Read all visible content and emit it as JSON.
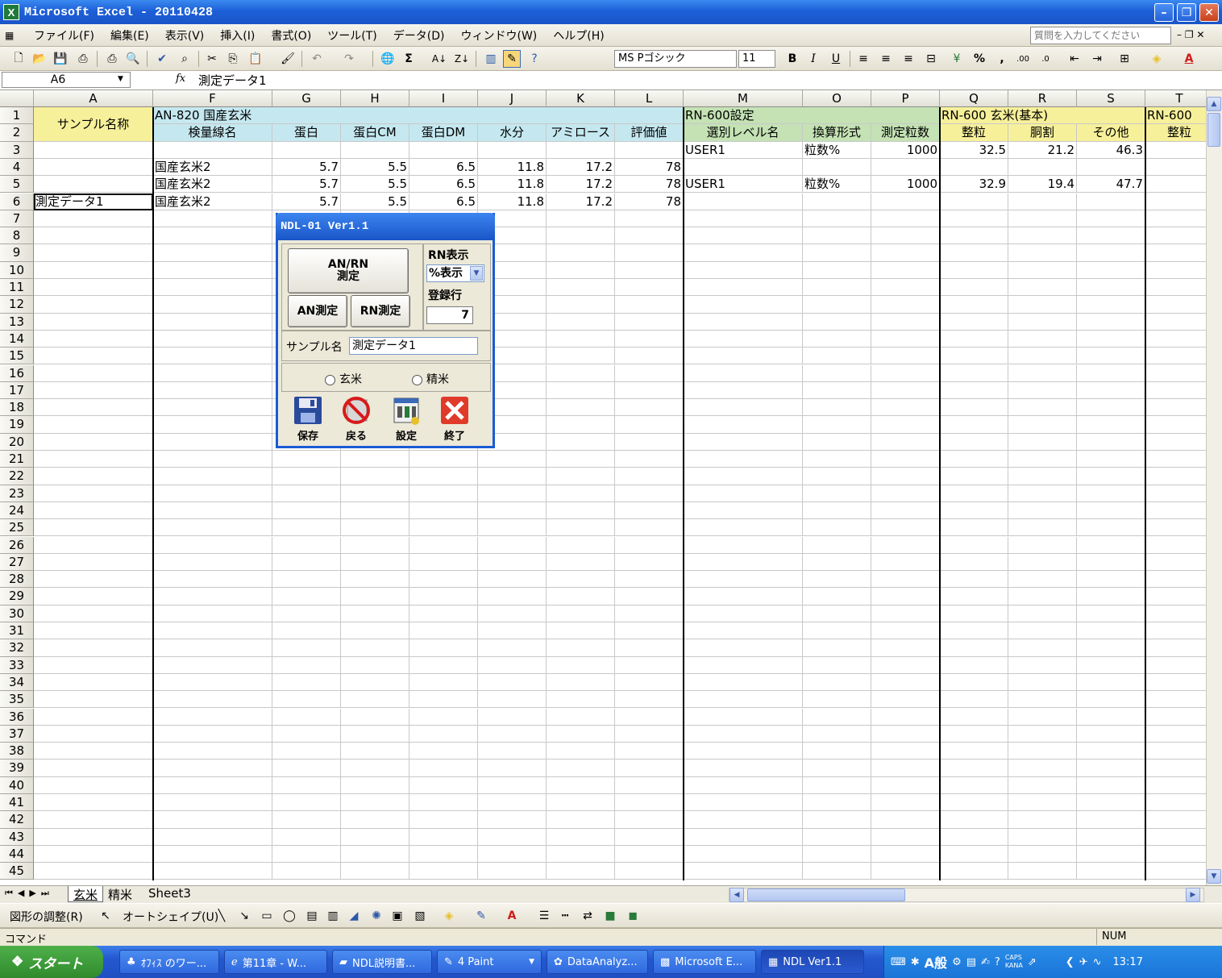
{
  "window": {
    "title": "Microsoft Excel - 20110428"
  },
  "menu": [
    "ファイル(F)",
    "編集(E)",
    "表示(V)",
    "挿入(I)",
    "書式(O)",
    "ツール(T)",
    "データ(D)",
    "ウィンドウ(W)",
    "ヘルプ(H)"
  ],
  "help_box": {
    "placeholder": "質問を入力してください"
  },
  "font": {
    "name": "MS Pゴシック",
    "size": "11"
  },
  "formula": {
    "namebox": "A6",
    "fx": "fx",
    "value": "測定データ1"
  },
  "columns": [
    "A",
    "F",
    "G",
    "H",
    "I",
    "J",
    "K",
    "L",
    "M",
    "O",
    "P",
    "Q",
    "R",
    "S",
    "T"
  ],
  "row1": {
    "A": "サンプル名称",
    "F": "AN-820 国産玄米",
    "M": "RN-600設定",
    "Q": "RN-600 玄米(基本)",
    "T": "RN-600"
  },
  "row2": {
    "F": "検量線名",
    "G": "蛋白",
    "H": "蛋白CM",
    "I": "蛋白DM",
    "J": "水分",
    "K": "アミロース",
    "L": "評価値",
    "M": "選別レベル名",
    "O": "換算形式",
    "P": "測定粒数",
    "Q": "整粒",
    "R": "胴割",
    "S": "その他",
    "T": "整粒"
  },
  "rows": [
    {
      "A": "",
      "F": "",
      "G": "",
      "H": "",
      "I": "",
      "J": "",
      "K": "",
      "L": "",
      "M": "USER1",
      "O": "粒数%",
      "P": "1000",
      "Q": "32.5",
      "R": "21.2",
      "S": "46.3"
    },
    {
      "A": "",
      "F": "国産玄米2",
      "G": "5.7",
      "H": "5.5",
      "I": "6.5",
      "J": "11.8",
      "K": "17.2",
      "L": "78",
      "M": "",
      "O": "",
      "P": "",
      "Q": "",
      "R": "",
      "S": ""
    },
    {
      "A": "",
      "F": "国産玄米2",
      "G": "5.7",
      "H": "5.5",
      "I": "6.5",
      "J": "11.8",
      "K": "17.2",
      "L": "78",
      "M": "USER1",
      "O": "粒数%",
      "P": "1000",
      "Q": "32.9",
      "R": "19.4",
      "S": "47.7"
    },
    {
      "A": "測定データ1",
      "F": "国産玄米2",
      "G": "5.7",
      "H": "5.5",
      "I": "6.5",
      "J": "11.8",
      "K": "17.2",
      "L": "78",
      "M": "",
      "O": "",
      "P": "",
      "Q": "",
      "R": "",
      "S": ""
    }
  ],
  "sheet_tabs": [
    "玄米",
    "精米",
    "Sheet3"
  ],
  "drawbar": {
    "adjust": "図形の調整(R)",
    "autoshape": "オートシェイプ(U)"
  },
  "status": {
    "mode": "コマンド",
    "num": "NUM"
  },
  "dialog": {
    "title": "NDL-01 Ver1.1",
    "anrn_line1": "AN/RN",
    "anrn_line2": "測定",
    "an_btn": "AN測定",
    "rn_btn": "RN測定",
    "rn_display_label": "RN表示",
    "rn_display_value": "%表示",
    "reg_row_label": "登録行",
    "reg_row_value": "7",
    "sample_label": "サンプル名",
    "sample_value": "測定データ1",
    "radio_brown": "玄米",
    "radio_polished": "精米",
    "save": "保存",
    "back": "戻る",
    "settings": "設定",
    "exit": "終了"
  },
  "taskbar": {
    "start": "スタート",
    "items": [
      "ｵﾌｨｽ のワー...",
      "第11章 - W...",
      "NDL説明書...",
      "4 Paint",
      "DataAnalyz...",
      "Microsoft E...",
      "NDL Ver1.1"
    ],
    "ime": "A般",
    "caps": "CAPS",
    "kana": "KANA",
    "clock": "13:17"
  }
}
